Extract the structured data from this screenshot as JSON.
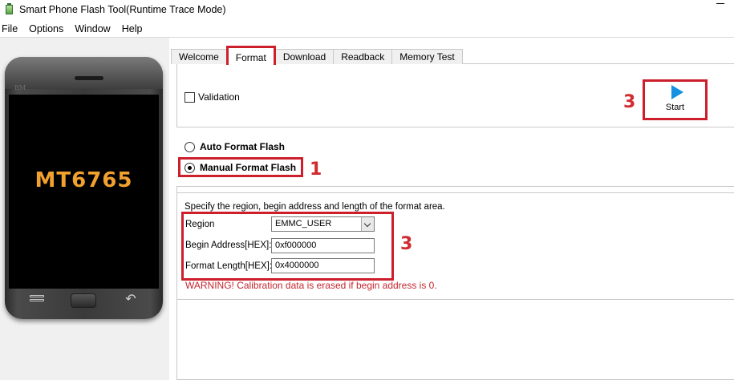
{
  "window": {
    "title": "Smart Phone Flash Tool(Runtime Trace Mode)"
  },
  "menu": {
    "items": [
      "File",
      "Options",
      "Window",
      "Help"
    ]
  },
  "phone": {
    "brand": "BM",
    "chip": "MT6765",
    "back_glyph": "↶"
  },
  "tabs": [
    {
      "label": "Welcome",
      "active": false
    },
    {
      "label": "Format",
      "active": true
    },
    {
      "label": "Download",
      "active": false
    },
    {
      "label": "Readback",
      "active": false
    },
    {
      "label": "Memory Test",
      "active": false
    }
  ],
  "format": {
    "validation_label": "Validation",
    "validation_checked": false,
    "start_label": "Start",
    "auto_label": "Auto Format Flash",
    "manual_label": "Manual Format Flash",
    "selected_mode": "manual",
    "description": "Specify the region, begin address and length of the format area.",
    "region_label": "Region",
    "region_value": "EMMC_USER",
    "begin_label": "Begin Address[HEX]:",
    "begin_value": "0xf000000",
    "length_label": "Format Length[HEX]:",
    "length_value": "0x4000000",
    "warning": "WARNING! Calibration data is erased if begin address is 0."
  },
  "annotations": {
    "step_start": "3",
    "step_manual": "1",
    "step_fields": "3"
  },
  "colors": {
    "highlight": "#cc1f2b",
    "warning": "#c4262e",
    "chip_text": "#f2a12f",
    "play_icon": "#1591e0"
  }
}
